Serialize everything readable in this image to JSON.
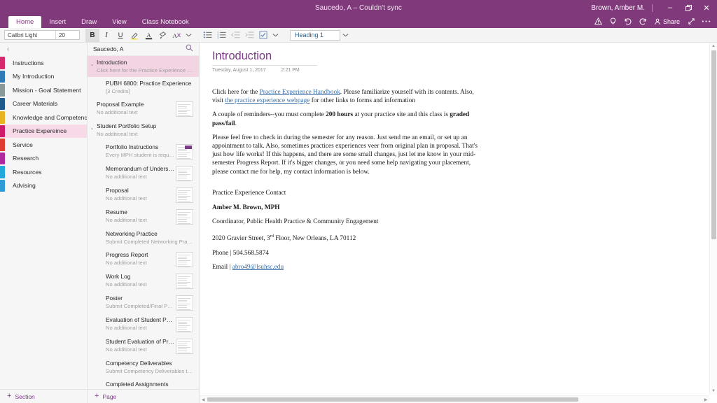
{
  "titlebar": {
    "document_title": "Saucedo, A – Couldn't sync",
    "user_name": "Brown, Amber M.",
    "minimize_label": "–",
    "restore_label": "❐",
    "close_label": "✕"
  },
  "ribbon": {
    "tabs": [
      {
        "label": "Home",
        "active": true
      },
      {
        "label": "Insert",
        "active": false
      },
      {
        "label": "Draw",
        "active": false
      },
      {
        "label": "View",
        "active": false
      },
      {
        "label": "Class Notebook",
        "active": false
      }
    ],
    "share_label": "Share",
    "icons": {
      "warning": "warning-icon",
      "tell_me": "lightbulb-icon",
      "undo": "undo-icon",
      "redo": "redo-icon",
      "share": "share-person-icon",
      "expand": "expand-icon",
      "more": "more-options-icon"
    }
  },
  "toolbar": {
    "font_name": "Calibri Light",
    "font_size": "20",
    "bold_label": "B",
    "italic_label": "I",
    "underline_label": "U",
    "highlight_label": "highlighter-icon",
    "font_color_label": "A",
    "format_painter_label": "format-painter-icon",
    "clear_formatting_label": "clear-formatting-icon",
    "bullets_label": "bullet-list-icon",
    "numbering_label": "numbered-list-icon",
    "decrease_indent_label": "decrease-indent-icon",
    "increase_indent_label": "increase-indent-icon",
    "todo_tag_label": "checkbox-tag-icon",
    "style_value": "Heading 1",
    "overflow_chevron": "⌄"
  },
  "sections": {
    "collapse_label": "‹",
    "add_section_label": "Section",
    "items": [
      {
        "label": "Instructions",
        "color": "#D6286E",
        "active": false
      },
      {
        "label": "My Introduction",
        "color": "#2E7BB5",
        "active": false
      },
      {
        "label": "Mission - Goal Statement",
        "color": "#8A9A9A",
        "active": false
      },
      {
        "label": "Career Materials",
        "color": "#1F5C8C",
        "active": false
      },
      {
        "label": "Knowledge and Competencies",
        "color": "#E8B41F",
        "active": false
      },
      {
        "label": "Practice Expereince",
        "color": "#CE1B6B",
        "active": true
      },
      {
        "label": "Service",
        "color": "#E03C31",
        "active": false
      },
      {
        "label": "Research",
        "color": "#B02A9E",
        "active": false
      },
      {
        "label": "Resources",
        "color": "#23A8DB",
        "active": false
      },
      {
        "label": "Advising",
        "color": "#2C9BD6",
        "active": false
      }
    ]
  },
  "pages": {
    "search_value": "Saucedo, A",
    "search_placeholder": "Search",
    "search_icon": "search-icon",
    "add_page_label": "Page",
    "items": [
      {
        "title": "Introduction",
        "subtitle": "Click here for the Practice Experience Handbo…",
        "selected": true,
        "arrow": "⌄",
        "indent": false,
        "thumb": false
      },
      {
        "title": "PUBH 6800: Practice Experience",
        "subtitle": "[3 Credits]",
        "selected": false,
        "arrow": "",
        "indent": true,
        "thumb": false
      },
      {
        "title": "Proposal Example",
        "subtitle": "No additional text",
        "selected": false,
        "arrow": "",
        "indent": false,
        "thumb": true
      },
      {
        "title": "Student Portfolio Setup",
        "subtitle": "No additional text",
        "selected": false,
        "arrow": "⌄",
        "indent": false,
        "thumb": false
      },
      {
        "title": "Portfolio Instructions",
        "subtitle": "Every MPH student is required to cr…",
        "selected": false,
        "arrow": "",
        "indent": true,
        "thumb": true,
        "thumb_accent": true
      },
      {
        "title": "Memorandum of Understanding",
        "subtitle": "No additional text",
        "selected": false,
        "arrow": "",
        "indent": true,
        "thumb": true
      },
      {
        "title": "Proposal",
        "subtitle": "No additional text",
        "selected": false,
        "arrow": "",
        "indent": true,
        "thumb": true
      },
      {
        "title": "Resume",
        "subtitle": "No additional text",
        "selected": false,
        "arrow": "",
        "indent": true,
        "thumb": true
      },
      {
        "title": "Networking Practice",
        "subtitle": "Submit Completed Networking Practice Assi…",
        "selected": false,
        "arrow": "",
        "indent": true,
        "thumb": false
      },
      {
        "title": "Progress Report",
        "subtitle": "No additional text",
        "selected": false,
        "arrow": "",
        "indent": true,
        "thumb": true
      },
      {
        "title": "Work Log",
        "subtitle": "No additional text",
        "selected": false,
        "arrow": "",
        "indent": true,
        "thumb": true
      },
      {
        "title": "Poster",
        "subtitle": "Submit Completed/Final Poster",
        "selected": false,
        "arrow": "",
        "indent": true,
        "thumb": true
      },
      {
        "title": "Evaluation of Student Performance",
        "subtitle": "No additional text",
        "selected": false,
        "arrow": "",
        "indent": true,
        "thumb": true
      },
      {
        "title": "Student Evaluation of Practice Exp…",
        "subtitle": "No additional text",
        "selected": false,
        "arrow": "",
        "indent": true,
        "thumb": true
      },
      {
        "title": "Competency Deliverables",
        "subtitle": "Submit Competency Deliverables to portfolio",
        "selected": false,
        "arrow": "",
        "indent": true,
        "thumb": false
      },
      {
        "title": "Completed Assignments",
        "subtitle": "",
        "selected": false,
        "arrow": "",
        "indent": true,
        "thumb": false
      }
    ]
  },
  "note": {
    "title": "Introduction",
    "date": "Tuesday, August 1, 2017",
    "time": "2:21 PM",
    "para1_before_link": "Click here for the ",
    "para1_link1": "Practice Experience Handbook",
    "para1_mid": ".  Please familiarize yourself with its contents.  Also, visit ",
    "para1_link2": "the practice experience webpage",
    "para1_after": " for other links to forms and information",
    "para2_a": "A couple of reminders--you must complete ",
    "para2_bold1": "200 hours",
    "para2_b": " at your practice site and this class is ",
    "para2_bold2": "graded pass/fail",
    "para2_c": ".",
    "para3": "Please feel free to check in during the semester for any reason.  Just send me an email, or set up an appointment to talk.  Also, sometimes practices experiences veer from original plan in proposal.  That's just how life works!  If this happens, and there are some small changes, just let me know in your mid-semester Progress Report.  If it's bigger changes, or you need some help navigating your placement, please contact me for help, my contact information is below.",
    "contact_heading": "Practice Experience Contact",
    "contact_name": "Amber M. Brown, MPH",
    "contact_role": "Coordinator, Public Health Practice & Community Engagement",
    "contact_address_1": "2020 Gravier Street, 3",
    "contact_address_sup": "rd",
    "contact_address_2": " Floor, New Orleans, LA 70112",
    "contact_phone": "Phone | 504.568.5874",
    "contact_email_label": "Email | ",
    "contact_email": "abro49@lsuhsc.edu"
  },
  "scrollbars": {
    "up_arrow": "▲",
    "down_arrow": "▼",
    "left_arrow": "◀",
    "right_arrow": "▶"
  }
}
